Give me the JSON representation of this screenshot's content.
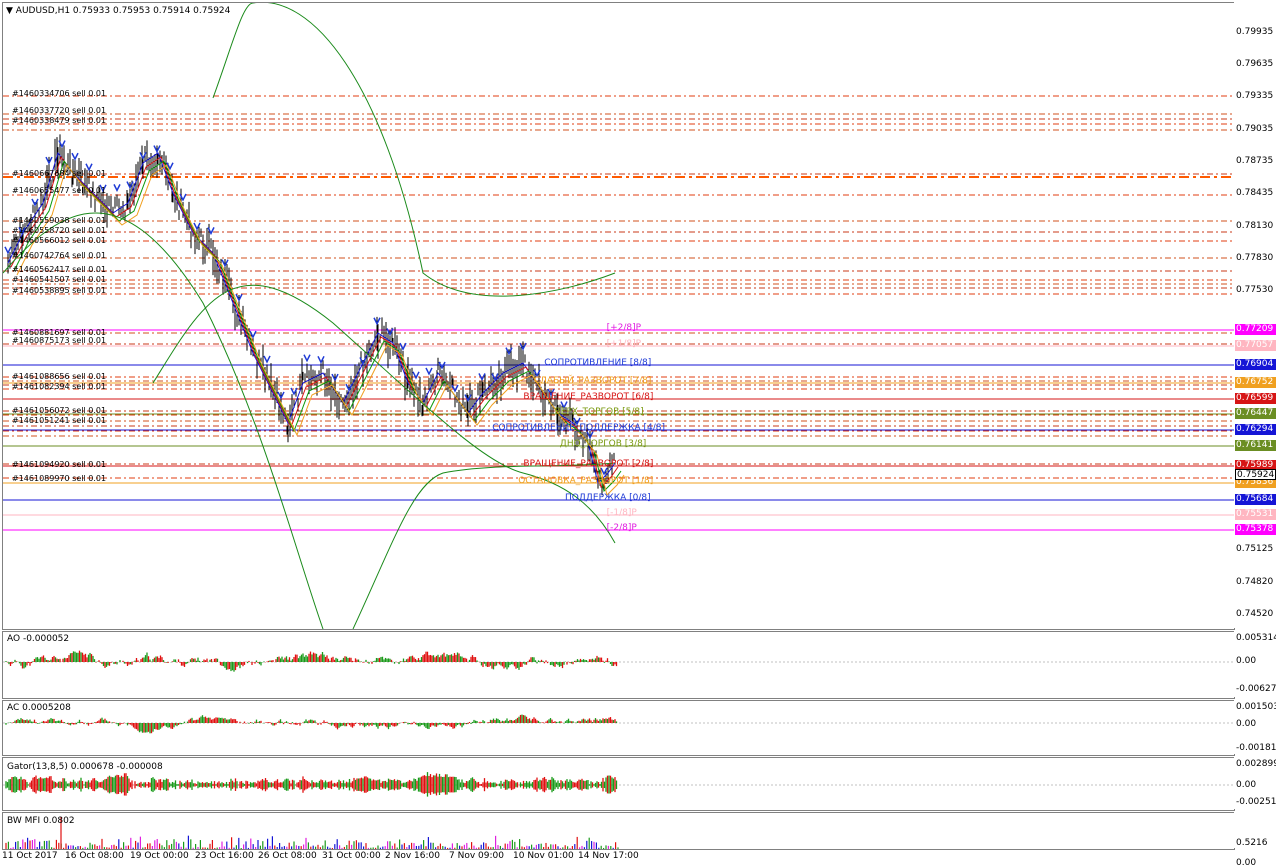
{
  "main": {
    "header": "AUDUSD,H1  0.75933 0.75953 0.75914 0.75924",
    "price_ticks": [
      "0.79935",
      "0.79635",
      "0.79335",
      "0.79035",
      "0.78735",
      "0.78435",
      "0.78130",
      "0.77830",
      "0.77530",
      "0.75125",
      "0.74820",
      "0.74520"
    ],
    "order_labels": [
      "#1460334706 sell 0.01",
      "#1460337720 sell 0.01",
      "#1460338479 sell 0.01",
      "#1460667684 sell 0.01",
      "#1460655477 sell 0.01",
      "#1460559038 sell 0.01",
      "#1460558720 sell 0.01",
      "#1460566012 sell 0.01",
      "#1460742764 sell 0.01",
      "#1460562417 sell 0.01",
      "#1460541507 sell 0.01",
      "#1460538895 sell 0.01",
      "#1460881697 sell 0.01",
      "#1460875173 sell 0.01",
      "#1461088656 sell 0.01",
      "#1461082394 sell 0.01",
      "#1461056072 sell 0.01",
      "#1461051241 sell 0.01",
      "#1461094920 sell 0.01",
      "#1461089970 sell 0.01"
    ],
    "murrey": [
      {
        "text": "[+2/8]P",
        "color": "#e020e0",
        "price": "0.77209",
        "bg": "#ff00ff"
      },
      {
        "text": "[+1/8]P",
        "color": "#ffb6c1",
        "price": "0.77057",
        "bg": "#ffb6c1"
      },
      {
        "text": "СОПРОТИВЛЕНИЕ [8/8]",
        "color": "#1e3ad6",
        "price": "0.76904",
        "bg": "#1515d6"
      },
      {
        "text": "СЛАБЫЙ_РАЗВОРОТ [7/8]",
        "color": "#f0a020",
        "price": "0.76752",
        "bg": "#f0a020"
      },
      {
        "text": "ВРАЩЕНИЕ_РАЗВОРОТ [6/8]",
        "color": "#d61515",
        "price": "0.76599",
        "bg": "#d61515"
      },
      {
        "text": "ВЕРХ_ТОРГОВ [5/8]",
        "color": "#7a9a10",
        "price": "0.76447",
        "bg": "#6b8e23"
      },
      {
        "text": "СОПРОТИВЛЕНИЕ_ПОДДЕРЖКА [4/8]",
        "color": "#1e3ad6",
        "price": "0.76294",
        "bg": "#1515d6"
      },
      {
        "text": "ДНО_ТОРГОВ [3/8]",
        "color": "#7a9a10",
        "price": "0.76141",
        "bg": "#6b8e23"
      },
      {
        "text": "ВРАЩЕНИЕ_РАЗВОРОТ [2/8]",
        "color": "#d61515",
        "price": "0.75989",
        "bg": "#d61515"
      },
      {
        "text": "ОСТАНОВКА_РАЗВОРОТ [1/8]",
        "color": "#f0a020",
        "price": "0.75836",
        "bg": "#f0a020"
      },
      {
        "text": "ПОДДЕРЖКА [0/8]",
        "color": "#1e3ad6",
        "price": "0.75684",
        "bg": "#1515d6"
      },
      {
        "text": "[-1/8]P",
        "color": "#ffb6c1",
        "price": "0.75531",
        "bg": "#ffb6c1"
      },
      {
        "text": "[-2/8]P",
        "color": "#e020e0",
        "price": "0.75378",
        "bg": "#ff00ff"
      }
    ],
    "current_price": "0.75924"
  },
  "ao": {
    "label": "AO -0.000052",
    "ticks": [
      "0.005314",
      "0.00",
      "-0.006274"
    ]
  },
  "ac": {
    "label": "AC 0.0005208",
    "ticks": [
      "0.001503",
      "0.00",
      "-0.001816"
    ]
  },
  "gator": {
    "label": "Gator(13,8,5) 0.000678 -0.000008",
    "ticks": [
      "0.002899",
      "0.00",
      "-0.002511"
    ]
  },
  "mfi": {
    "label": "BW MFI 0.0802",
    "ticks": [
      "0.5216",
      "0.00"
    ]
  },
  "time_axis": [
    "11 Oct 2017",
    "16 Oct 08:00",
    "19 Oct 00:00",
    "23 Oct 16:00",
    "26 Oct 08:00",
    "31 Oct 00:00",
    "2 Nov 16:00",
    "7 Nov 09:00",
    "10 Nov 01:00",
    "14 Nov 17:00"
  ]
}
